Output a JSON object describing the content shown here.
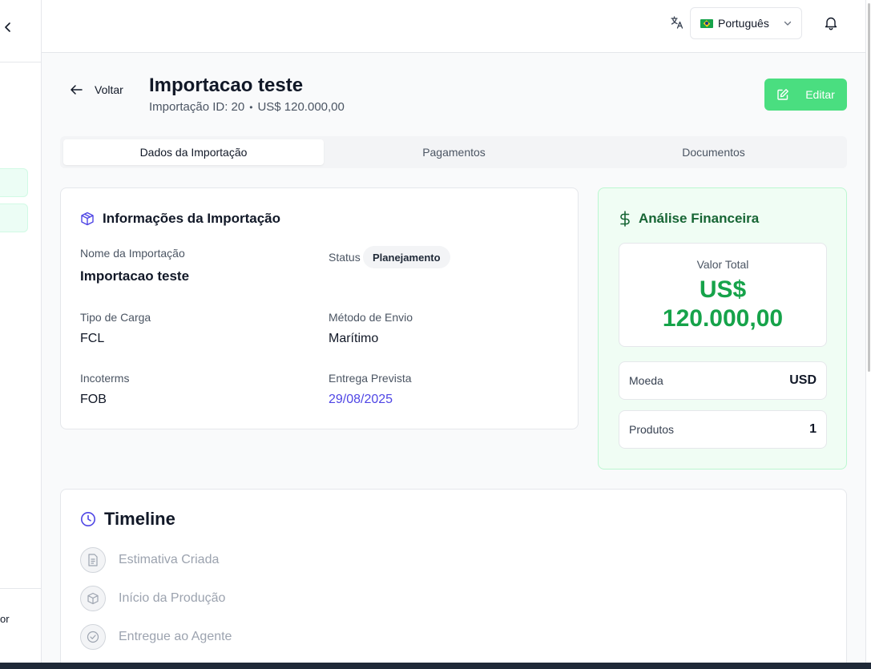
{
  "sidebar": {
    "collapse_icon": "chevron-left-icon",
    "user_fragment": "or"
  },
  "topbar": {
    "translate_icon": "translate-icon",
    "language_selected": "Português",
    "flag_icon": "brazil-flag-icon",
    "notification_icon": "bell-icon"
  },
  "header": {
    "back_label": "Voltar",
    "title": "Importacao teste",
    "subtitle_id": "Importação ID: 20",
    "subtitle_separator": "•",
    "subtitle_value": "US$ 120.000,00",
    "edit_label": "Editar"
  },
  "tabs": [
    {
      "label": "Dados da Importação",
      "active": true
    },
    {
      "label": "Pagamentos",
      "active": false
    },
    {
      "label": "Documentos",
      "active": false
    }
  ],
  "info": {
    "title": "Informações da Importação",
    "name_label": "Nome da Importação",
    "name_value": "Importacao teste",
    "status_label": "Status",
    "status_value": "Planejamento",
    "cargo_label": "Tipo de Carga",
    "cargo_value": "FCL",
    "shipping_label": "Método de Envio",
    "shipping_value": "Marítimo",
    "incoterms_label": "Incoterms",
    "incoterms_value": "FOB",
    "delivery_label": "Entrega Prevista",
    "delivery_value": "29/08/2025"
  },
  "finance": {
    "title": "Análise Financeira",
    "total_label": "Valor Total",
    "total_value_line1": "US$",
    "total_value_line2": "120.000,00",
    "currency_label": "Moeda",
    "currency_value": "USD",
    "products_label": "Produtos",
    "products_value": "1"
  },
  "timeline": {
    "title": "Timeline",
    "items": [
      {
        "label": "Estimativa Criada",
        "icon": "document-icon"
      },
      {
        "label": "Início da Produção",
        "icon": "box-icon"
      },
      {
        "label": "Entregue ao Agente",
        "icon": "check-circle-icon"
      }
    ]
  },
  "colors": {
    "accent_green": "#4ade80",
    "value_green": "#16a34a",
    "date_blue": "#4f46e5",
    "icon_indigo": "#4f46e5"
  }
}
